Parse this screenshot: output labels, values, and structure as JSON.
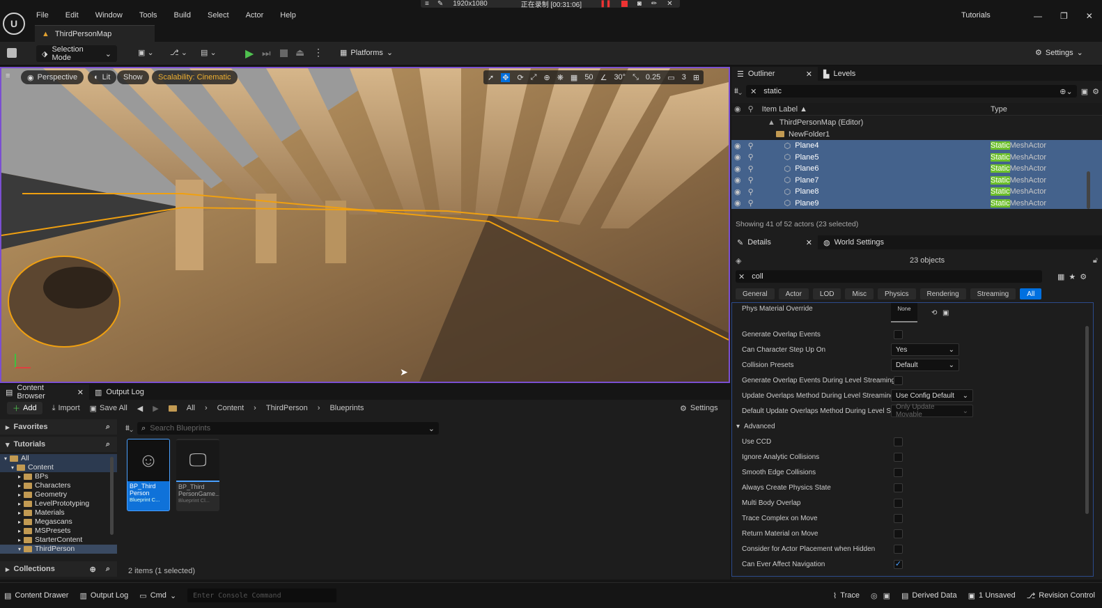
{
  "menu": [
    "File",
    "Edit",
    "Window",
    "Tools",
    "Build",
    "Select",
    "Actor",
    "Help"
  ],
  "recording": {
    "resolution": "1920x1080",
    "status": "正在录制 [00:31:06]"
  },
  "map_tab": "ThirdPersonMap",
  "top_right": {
    "tutorials": "Tutorials"
  },
  "toolbar": {
    "selection_mode": "Selection Mode",
    "platforms": "Platforms",
    "settings": "Settings"
  },
  "viewport": {
    "perspective": "Perspective",
    "lit": "Lit",
    "show": "Show",
    "scalability": "Scalability: Cinematic",
    "grid_snap": "50",
    "rot_snap": "30°",
    "scale_snap": "0.25",
    "cam_speed": "3"
  },
  "outliner": {
    "tab_label": "Outliner",
    "levels_label": "Levels",
    "search_value": "static",
    "col_label": "Item Label",
    "col_type": "Type",
    "map_row": "ThirdPersonMap (Editor)",
    "folder_row": "NewFolder1",
    "items": [
      {
        "label": "Plane4",
        "type_hl": "Static",
        "type_rest": "MeshActor"
      },
      {
        "label": "Plane5",
        "type_hl": "Static",
        "type_rest": "MeshActor"
      },
      {
        "label": "Plane6",
        "type_hl": "Static",
        "type_rest": "MeshActor"
      },
      {
        "label": "Plane7",
        "type_hl": "Static",
        "type_rest": "MeshActor"
      },
      {
        "label": "Plane8",
        "type_hl": "Static",
        "type_rest": "MeshActor"
      },
      {
        "label": "Plane9",
        "type_hl": "Static",
        "type_rest": "MeshActor"
      }
    ],
    "status": "Showing 41 of 52 actors (23 selected)"
  },
  "details": {
    "tab_label": "Details",
    "world_settings": "World Settings",
    "objects": "23 objects",
    "search_value": "coll",
    "filters": [
      "General",
      "Actor",
      "LOD",
      "Misc",
      "Physics",
      "Rendering",
      "Streaming",
      "All"
    ],
    "phys_material_label": "Phys Material Override",
    "phys_material_value": "None",
    "props": [
      {
        "label": "Generate Overlap Events",
        "kind": "check",
        "checked": false
      },
      {
        "label": "Can Character Step Up On",
        "kind": "dropdown",
        "value": "Yes"
      },
      {
        "label": "Collision Presets",
        "kind": "dropdown",
        "value": "Default"
      },
      {
        "label": "Generate Overlap Events During Level Streaming",
        "kind": "check",
        "checked": false
      },
      {
        "label": "Update Overlaps Method During Level Streaming",
        "kind": "dropdown",
        "value": "Use Config Default"
      },
      {
        "label": "Default Update Overlaps Method During Level S...",
        "kind": "dropdown",
        "value": "Only Update Movable",
        "disabled": true
      },
      {
        "label": "Advanced",
        "kind": "section"
      },
      {
        "label": "Use CCD",
        "kind": "check",
        "checked": false
      },
      {
        "label": "Ignore Analytic Collisions",
        "kind": "check",
        "checked": false
      },
      {
        "label": "Smooth Edge Collisions",
        "kind": "check",
        "checked": false
      },
      {
        "label": "Always Create Physics State",
        "kind": "check",
        "checked": false
      },
      {
        "label": "Multi Body Overlap",
        "kind": "check",
        "checked": false
      },
      {
        "label": "Trace Complex on Move",
        "kind": "check",
        "checked": false
      },
      {
        "label": "Return Material on Move",
        "kind": "check",
        "checked": false
      },
      {
        "label": "Consider for Actor Placement when Hidden",
        "kind": "check",
        "checked": false
      },
      {
        "label": "Can Ever Affect Navigation",
        "kind": "check",
        "checked": true
      }
    ]
  },
  "content_browser": {
    "tab_label": "Content Browser",
    "output_log_tab": "Output Log",
    "add": "Add",
    "import": "Import",
    "save_all": "Save All",
    "settings": "Settings",
    "path": [
      "All",
      "Content",
      "ThirdPerson",
      "Blueprints"
    ],
    "search_placeholder": "Search Blueprints",
    "favorites": "Favorites",
    "tutorials": "Tutorials",
    "collections": "Collections",
    "tree": [
      {
        "label": "All",
        "level": 0
      },
      {
        "label": "Content",
        "level": 1
      },
      {
        "label": "BPs",
        "level": 2
      },
      {
        "label": "Characters",
        "level": 2
      },
      {
        "label": "Geometry",
        "level": 2
      },
      {
        "label": "LevelPrototyping",
        "level": 2
      },
      {
        "label": "Materials",
        "level": 2
      },
      {
        "label": "Megascans",
        "level": 2
      },
      {
        "label": "MSPresets",
        "level": 2
      },
      {
        "label": "StarterContent",
        "level": 2
      },
      {
        "label": "ThirdPerson",
        "level": 2
      }
    ],
    "assets": [
      {
        "line1": "BP_Third",
        "line2": "Person",
        "type": "Blueprint C..."
      },
      {
        "line1": "BP_Third",
        "line2": "PersonGame...",
        "type": "Blueprint Cl..."
      }
    ],
    "count": "2 items (1 selected)"
  },
  "statusbar": {
    "content_drawer": "Content Drawer",
    "output_log": "Output Log",
    "cmd": "Cmd",
    "console_placeholder": "Enter Console Command",
    "trace": "Trace",
    "derived_data": "Derived Data",
    "unsaved": "1 Unsaved",
    "revision_control": "Revision Control"
  },
  "colors": {
    "accent": "#0070e0",
    "selection": "#44628c",
    "highlight": "#6dbf2b",
    "viewport_border": "#7b4fd1",
    "scalability": "#f0b030"
  }
}
